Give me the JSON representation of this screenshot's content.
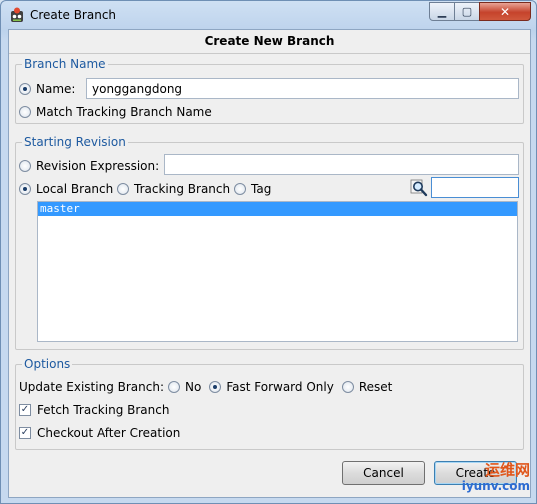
{
  "window": {
    "title": "Create Branch",
    "buttons": {
      "minimize": "▁",
      "maximize": "▢",
      "close": "✕"
    }
  },
  "dialog": {
    "heading": "Create New Branch"
  },
  "branch_name": {
    "legend": "Branch Name",
    "name_label": "Name:",
    "name_value": "yonggangdong",
    "name_selected": true,
    "match_label": "Match Tracking Branch Name",
    "match_selected": false
  },
  "starting_revision": {
    "legend": "Starting Revision",
    "expression_label": "Revision Expression:",
    "expression_value": "",
    "expression_selected": false,
    "local_branch_label": "Local Branch",
    "local_branch_selected": true,
    "tracking_branch_label": "Tracking Branch",
    "tracking_branch_selected": false,
    "tag_label": "Tag",
    "tag_selected": false,
    "filter_value": "",
    "icons": {
      "search": "search-icon"
    },
    "branches": [
      "master"
    ],
    "selected_branch": "master"
  },
  "options": {
    "legend": "Options",
    "update_label": "Update Existing Branch:",
    "update_choices": [
      {
        "label": "No",
        "selected": false
      },
      {
        "label": "Fast Forward Only",
        "selected": true
      },
      {
        "label": "Reset",
        "selected": false
      }
    ],
    "fetch_label": "Fetch Tracking Branch",
    "fetch_checked": true,
    "checkout_label": "Checkout After Creation",
    "checkout_checked": true
  },
  "footer": {
    "cancel_label": "Cancel",
    "create_label": "Create"
  },
  "watermark": {
    "line1": "运维网",
    "line2": "iyunv.com"
  },
  "colors": {
    "accent": "#1e5aa0",
    "selection": "#3399ff",
    "client_bg": "#efefef"
  }
}
